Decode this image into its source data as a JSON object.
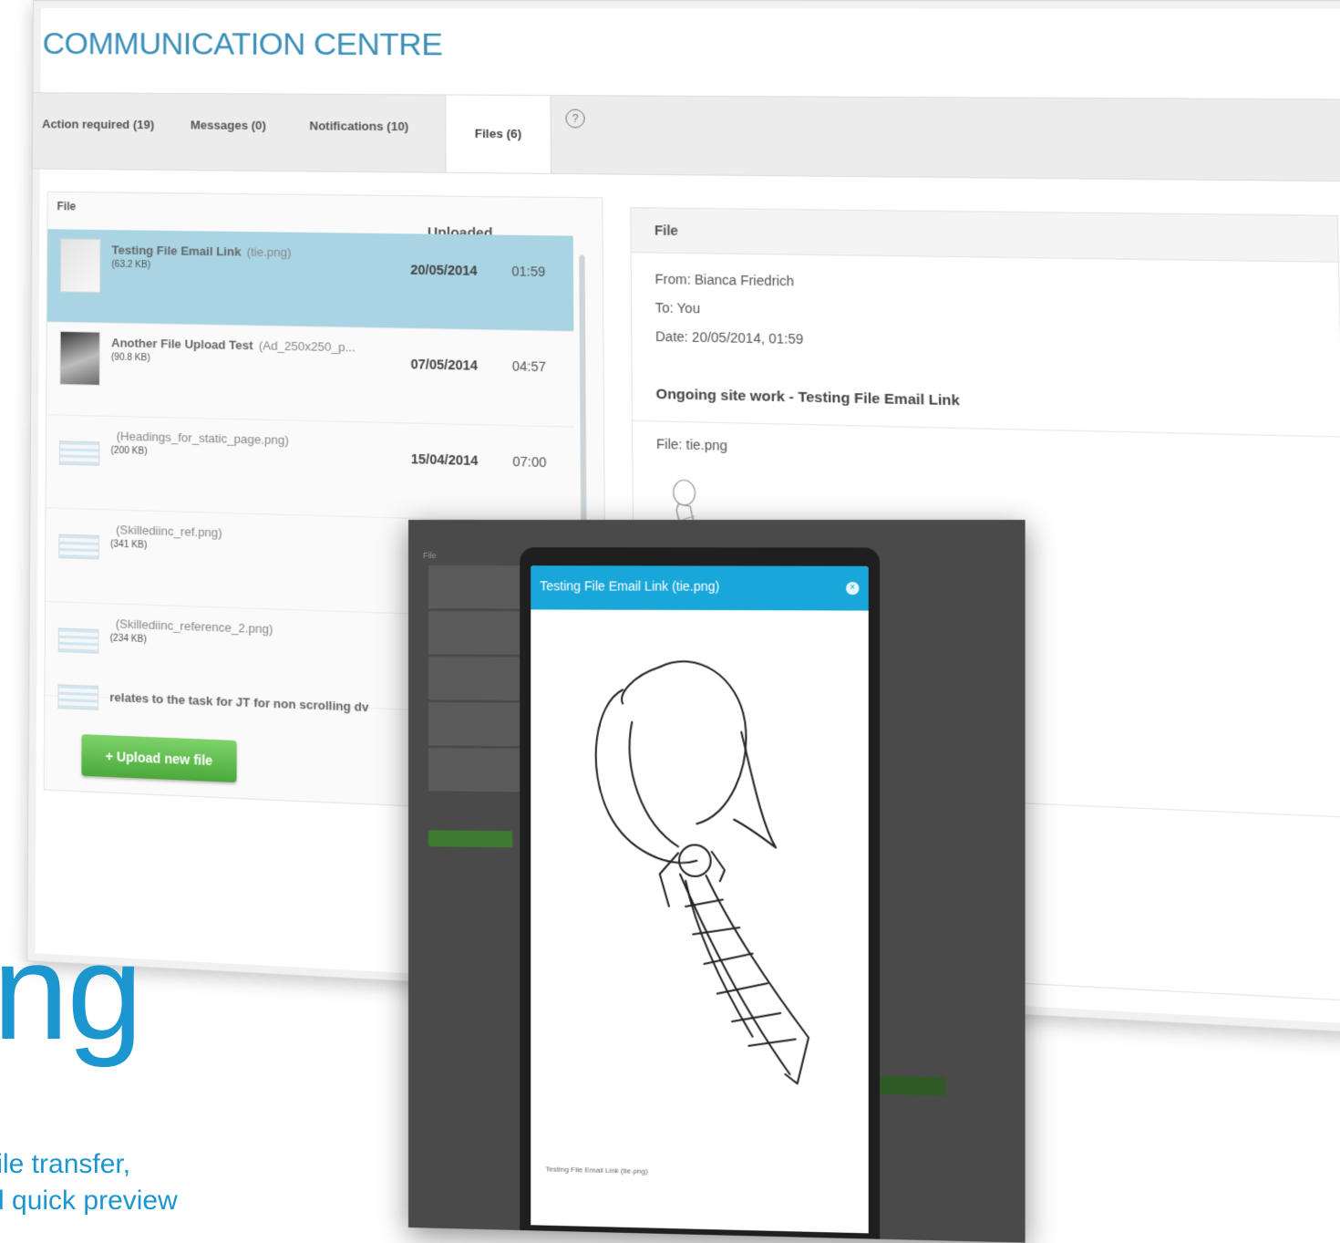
{
  "header": {
    "title": "COMMUNICATION CENTRE"
  },
  "tabs": [
    {
      "label": "Action required (19)"
    },
    {
      "label": "Messages (0)"
    },
    {
      "label": "Notifications (10)"
    },
    {
      "label": "Files (6)",
      "active": true
    }
  ],
  "help_icon": "help-circle-icon",
  "file_list": {
    "col_file": "File",
    "col_uploaded": "Uploaded",
    "rows": [
      {
        "title": "Testing File Email Link",
        "file": "(tie.png)",
        "size": "(63.2 KB)",
        "date": "20/05/2014",
        "time": "01:59",
        "selected": true
      },
      {
        "title": "Another File Upload Test",
        "file": "(Ad_250x250_p...",
        "size": "(90.8 KB)",
        "date": "07/05/2014",
        "time": "04:57"
      },
      {
        "title": "",
        "file": "(Headings_for_static_page.png)",
        "size": "(200 KB)",
        "date": "15/04/2014",
        "time": "07:00"
      },
      {
        "title": "",
        "file": "(Skillediinc_ref.png)",
        "size": "(341 KB)",
        "date": "",
        "time": ""
      },
      {
        "title": "",
        "file": "(Skillediinc_reference_2.png)",
        "size": "(234 KB)",
        "date": "",
        "time": ""
      },
      {
        "title": "relates to the task for JT for non scrolling dv",
        "file": "",
        "size": "",
        "date": "",
        "time": ""
      }
    ],
    "upload_button": "+ Upload new file"
  },
  "file_detail": {
    "heading": "File",
    "from": "From: Bianca Friedrich",
    "to": "To: You",
    "date": "Date: 20/05/2014, 01:59",
    "subject": "Ongoing site work - Testing File Email Link",
    "file": "File: tie.png"
  },
  "tablet": {
    "bg_label": "File",
    "modal_title": "Testing File Email Link (tie.png)",
    "close_icon": "close-icon",
    "caption": "Testing File Email Link (tie.png)"
  },
  "marketing": {
    "big_word": "ng",
    "line1": "file transfer,",
    "line2": "d quick preview"
  },
  "colors": {
    "accent_blue": "#3c8fb8",
    "modal_header": "#19a7d9",
    "selected_row": "#a8d4e4",
    "upload_green": "#5cb848",
    "marketing_blue": "#1c96cf"
  }
}
